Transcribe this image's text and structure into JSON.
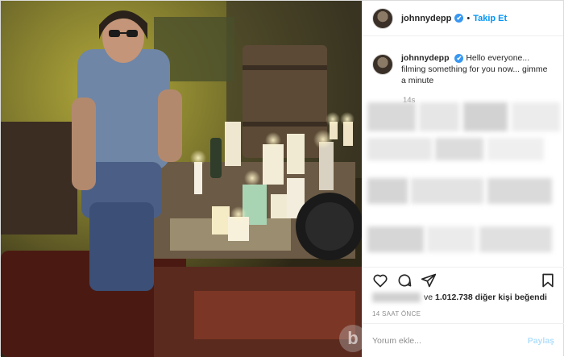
{
  "post": {
    "username": "johnnydepp",
    "verified_mark": "✔",
    "follow_label": "Takip Et",
    "caption_user": "johnnydepp",
    "caption_text": "Hello everyone... filming something for you now... gimme a minute",
    "caption_time": "14s",
    "likes_text_prefix": "ve",
    "likes_count": "1.012.738",
    "likes_text_suffix": "diğer kişi beğendi",
    "timestamp": "14 SAAT ÖNCE",
    "comment_placeholder": "Yorum ekle...",
    "post_button": "Paylaş"
  },
  "icons": [
    "heart-icon",
    "comment-icon",
    "share-icon",
    "bookmark-icon",
    "verified-icon"
  ],
  "colors": {
    "accent": "#0095f6",
    "verified": "#3897f0",
    "muted": "#8e8e8e",
    "text": "#262626"
  },
  "watermark": {
    "text": "b"
  }
}
